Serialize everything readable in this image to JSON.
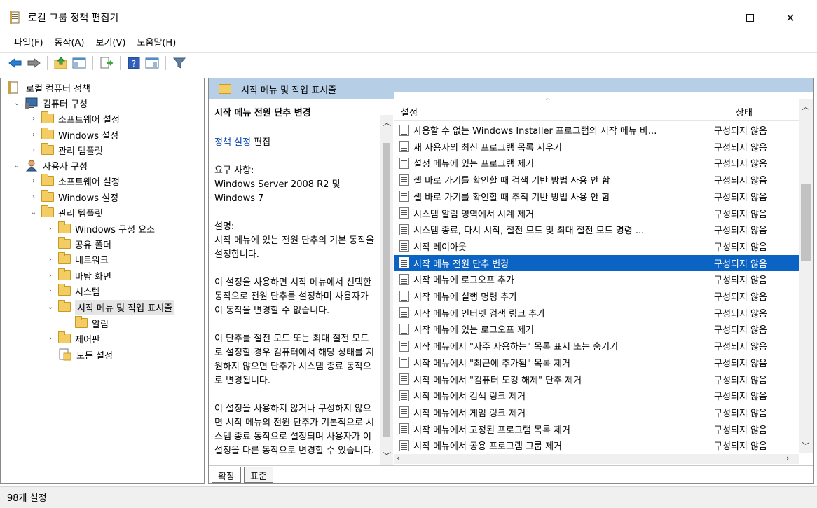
{
  "window": {
    "title": "로컬 그룹 정책 편집기"
  },
  "menu": [
    "파일(F)",
    "동작(A)",
    "보기(V)",
    "도움말(H)"
  ],
  "toolbar": {
    "icons": [
      "back-icon",
      "forward-icon",
      "up-folder-icon",
      "show-hide-tree-icon",
      "export-list-icon",
      "help-icon",
      "properties-icon",
      "filter-icon"
    ]
  },
  "tree": {
    "root": "로컬 컴퓨터 정책",
    "computer_config": "컴퓨터 구성",
    "computer_software": "소프트웨어 설정",
    "computer_windows": "Windows 설정",
    "computer_admin": "관리 템플릿",
    "user_config": "사용자 구성",
    "user_software": "소프트웨어 설정",
    "user_windows": "Windows 설정",
    "user_admin": "관리 템플릿",
    "windows_components": "Windows 구성 요소",
    "shared_folders": "공유 폴더",
    "network": "네트워크",
    "desktop": "바탕 화면",
    "system": "시스템",
    "start_menu": "시작 메뉴 및 작업 표시줄",
    "notifications": "알림",
    "control_panel": "제어판",
    "all_settings": "모든 설정"
  },
  "panel": {
    "header": "시작 메뉴 및 작업 표시줄",
    "desc_title": "시작 메뉴 전원 단추 변경",
    "policy_link": "정책 설정",
    "edit_label": "편집",
    "requirements": "요구 사항:\nWindows Server 2008 R2 및\nWindows 7",
    "description": "설명:\n시작 메뉴에 있는 전원 단추의 기본 동작을 설정합니다.",
    "para1": "이 설정을 사용하면 시작 메뉴에서 선택한 동작으로 전원 단추를 설정하며 사용자가 이 동작을 변경할 수 없습니다.",
    "para2": "이 단추를 절전 모드 또는 최대 절전 모드로 설정할 경우 컴퓨터에서 해당 상태를 지원하지 않으면 단추가 시스템 종료 동작으로 변경됩니다.",
    "para3": "이 설정을 사용하지 않거나 구성하지 않으면 시작 메뉴의 전원 단추가 기본적으로 시스템 종료 동작으로 설정되며 사용자가 이 설정을 다른 동작으로 변경할 수 있습니다."
  },
  "list": {
    "col_setting": "설정",
    "col_state": "상태",
    "rows": [
      {
        "name": "사용할 수 없는 Windows Installer 프로그램의 시작 메뉴 바...",
        "state": "구성되지 않음"
      },
      {
        "name": "새 사용자의 최신 프로그램 목록 지우기",
        "state": "구성되지 않음"
      },
      {
        "name": "설정 메뉴에 있는 프로그램 제거",
        "state": "구성되지 않음"
      },
      {
        "name": "셸 바로 가기를 확인할 때 검색 기반 방법 사용 안 함",
        "state": "구성되지 않음"
      },
      {
        "name": "셸 바로 가기를 확인할 때 추적 기반 방법 사용 안 함",
        "state": "구성되지 않음"
      },
      {
        "name": "시스템 알림 영역에서 시계 제거",
        "state": "구성되지 않음"
      },
      {
        "name": "시스템 종료, 다시 시작, 절전 모드 및 최대 절전 모드 명령 ...",
        "state": "구성되지 않음"
      },
      {
        "name": "시작 레이아웃",
        "state": "구성되지 않음"
      },
      {
        "name": "시작 메뉴 전원 단추 변경",
        "state": "구성되지 않음"
      },
      {
        "name": "시작 메뉴에 로그오프 추가",
        "state": "구성되지 않음"
      },
      {
        "name": "시작 메뉴에 실행 명령 추가",
        "state": "구성되지 않음"
      },
      {
        "name": "시작 메뉴에 인터넷 검색 링크 추가",
        "state": "구성되지 않음"
      },
      {
        "name": "시작 메뉴에 있는 로그오프 제거",
        "state": "구성되지 않음"
      },
      {
        "name": "시작 메뉴에서 \"자주 사용하는\" 목록 표시 또는 숨기기",
        "state": "구성되지 않음"
      },
      {
        "name": "시작 메뉴에서 \"최근에 추가됨\" 목록 제거",
        "state": "구성되지 않음"
      },
      {
        "name": "시작 메뉴에서 \"컴퓨터 도킹 해제\" 단추 제거",
        "state": "구성되지 않음"
      },
      {
        "name": "시작 메뉴에서 검색 링크 제거",
        "state": "구성되지 않음"
      },
      {
        "name": "시작 메뉴에서 게임 링크 제거",
        "state": "구성되지 않음"
      },
      {
        "name": "시작 메뉴에서 고정된 프로그램 목록 제거",
        "state": "구성되지 않음"
      },
      {
        "name": "시작 메뉴에서 공용 프로그램 그룹 제거",
        "state": "구성되지 않음"
      }
    ]
  },
  "tabs": {
    "extended": "확장",
    "standard": "표준"
  },
  "status": {
    "count": "98개 설정"
  }
}
